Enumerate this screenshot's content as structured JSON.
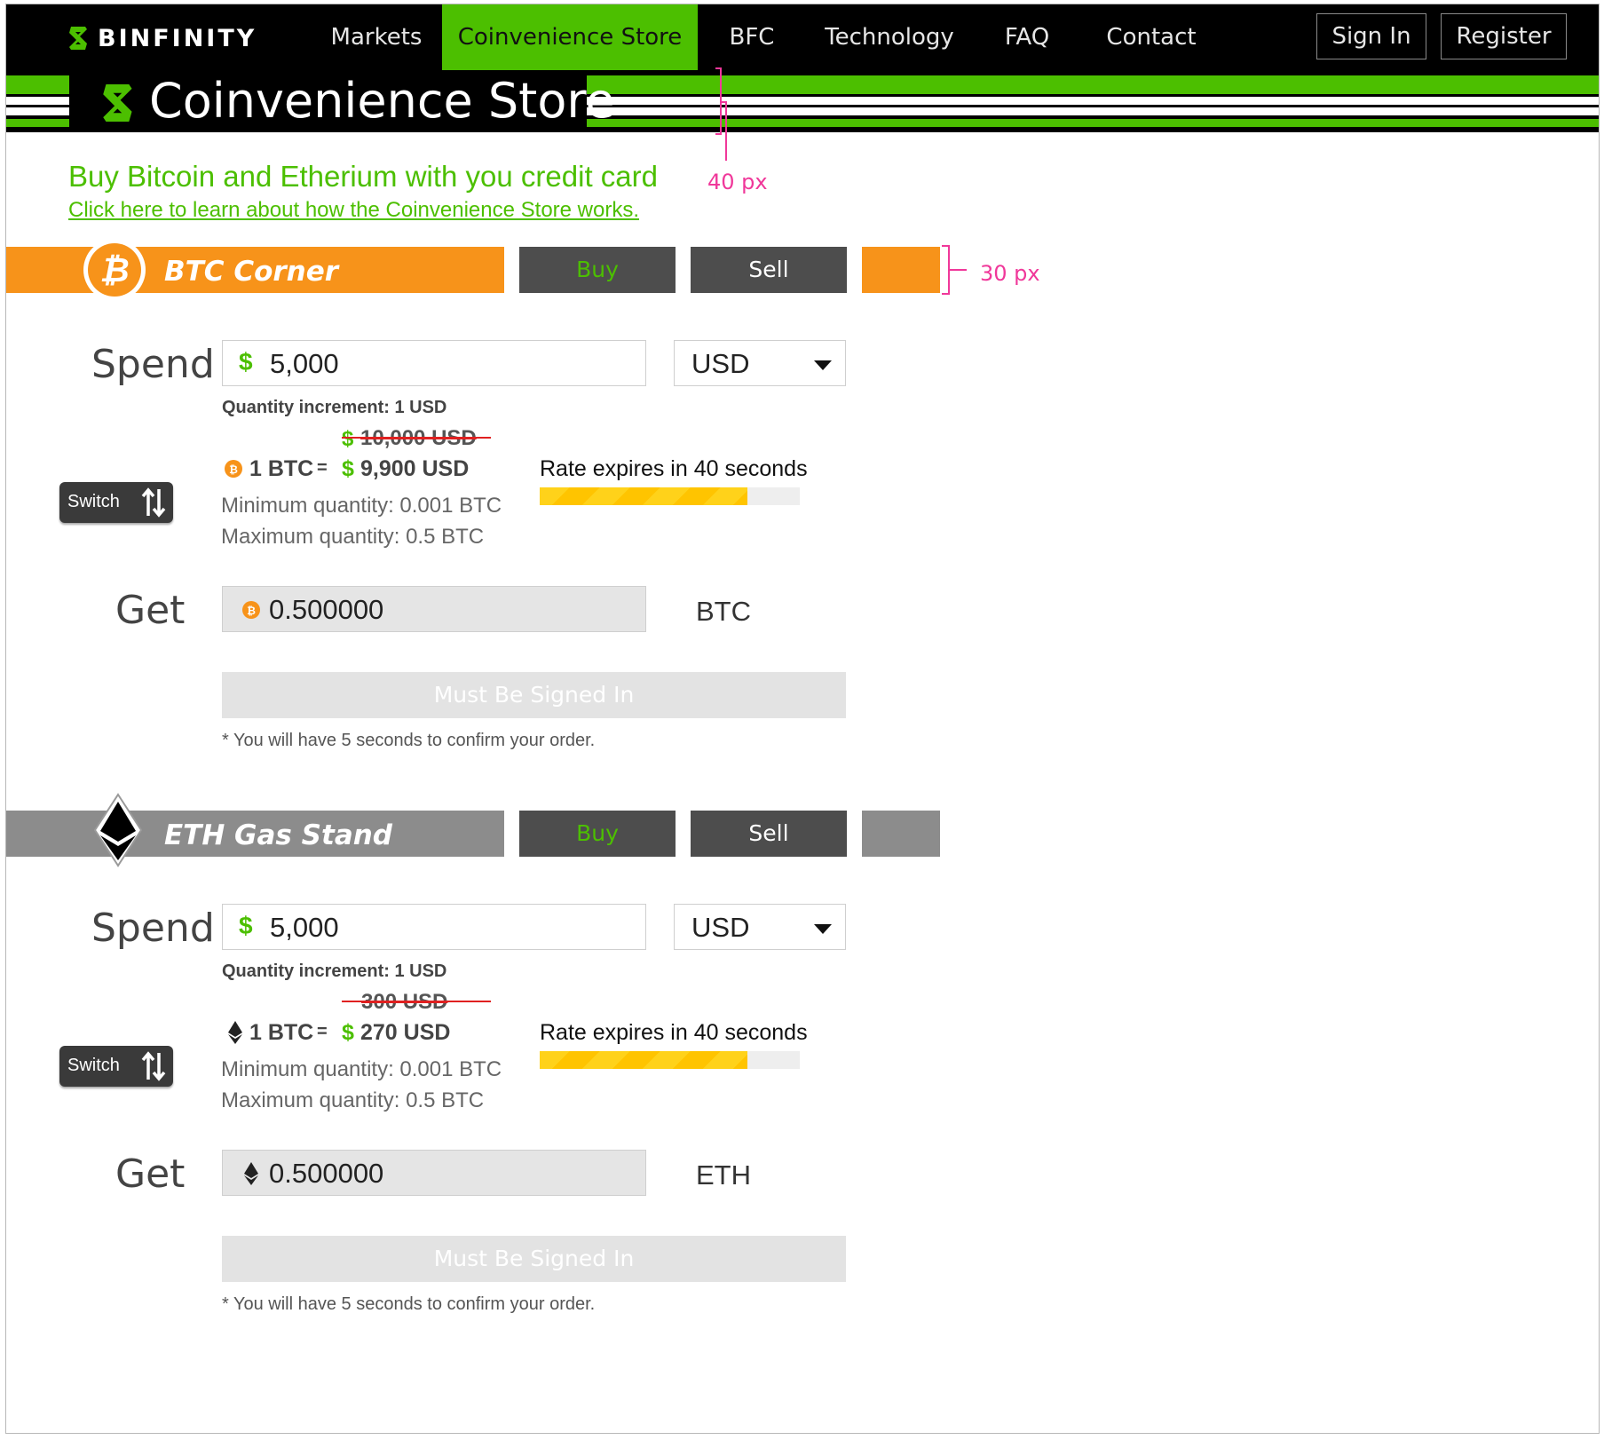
{
  "nav": {
    "brand": "BINFINITY",
    "items": [
      {
        "label": "Markets"
      },
      {
        "label": "Coinvenience Store",
        "active": true
      },
      {
        "label": "BFC"
      },
      {
        "label": "Technology"
      },
      {
        "label": "FAQ"
      },
      {
        "label": "Contact"
      }
    ],
    "sign_in": "Sign In",
    "register": "Register"
  },
  "banner": {
    "title": "Coinvenience Store"
  },
  "intro": {
    "headline": "Buy Bitcoin and Etherium with you credit card",
    "link": "Click here to learn about how the Coinvenience Store works."
  },
  "annotations": {
    "banner_height": "40 px",
    "bar_height": "30 px"
  },
  "colors": {
    "brand_green": "#4cbf00",
    "btc_orange": "#f7931a",
    "eth_gray": "#8c8c8c",
    "dark": "#000000",
    "annotation": "#f0389a"
  },
  "btc": {
    "title": "BTC Corner",
    "buy": "Buy",
    "sell": "Sell",
    "spend_label": "Spend",
    "dollar_sign": "$",
    "spend_value": "5,000",
    "currency": "USD",
    "increment": "Quantity increment: 1 USD",
    "old_rate": "10,000 USD",
    "rate_unit": "1 BTC",
    "rate_eq": "=",
    "new_rate": "9,900 USD",
    "min_qty": "Minimum quantity: 0.001 BTC",
    "max_qty": "Maximum quantity: 0.5 BTC",
    "expires": "Rate expires in 40 seconds",
    "expires_progress": 0.8,
    "switch": "Switch",
    "get_label": "Get",
    "get_value": "0.500000",
    "get_unit": "BTC",
    "submit": "Must Be Signed In",
    "note": "* You will have 5 seconds to confirm your order."
  },
  "eth": {
    "title": "ETH Gas Stand",
    "buy": "Buy",
    "sell": "Sell",
    "spend_label": "Spend",
    "dollar_sign": "$",
    "spend_value": "5,000",
    "currency": "USD",
    "increment": "Quantity increment: 1 USD",
    "old_rate": "300 USD",
    "rate_unit": "1 BTC",
    "rate_eq": "=",
    "new_rate": "270 USD",
    "min_qty": "Minimum quantity: 0.001 BTC",
    "max_qty": "Maximum quantity: 0.5 BTC",
    "expires": "Rate expires in 40 seconds",
    "expires_progress": 0.8,
    "switch": "Switch",
    "get_label": "Get",
    "get_value": "0.500000",
    "get_unit": "ETH",
    "submit": "Must Be Signed In",
    "note": "* You will have 5 seconds to confirm your order."
  }
}
